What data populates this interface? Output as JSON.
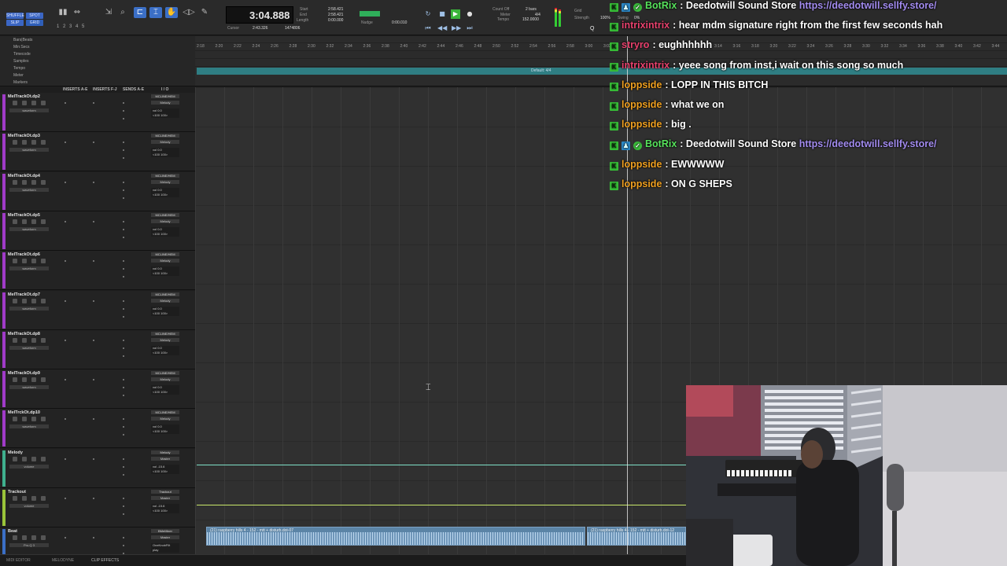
{
  "toolbar": {
    "mode_buttons": [
      "SHUFFLE",
      "SPOT",
      "SLIP",
      "GRID"
    ],
    "zoom_presets": [
      "1",
      "2",
      "3",
      "4",
      "5"
    ],
    "main_counter": "3:04.888",
    "counter_labels": [
      "Start",
      "End",
      "Length"
    ],
    "counter_values": [
      "2:58.421",
      "2:58.421",
      "0:00.000"
    ],
    "cursor_label": "Cursor",
    "cursor_value": "2:43.326",
    "samples_value": "1474806",
    "nudge_label": "Nudge",
    "nudge_value": "0:00.010",
    "count_off": "Count Off",
    "meter_label": "Meter",
    "tempo_label": "Tempo",
    "meter_value": "4/4",
    "tempo_value": "152.0000",
    "bars_label": "2 bars",
    "grid_label": "Grid",
    "strength_label": "Strength",
    "swing_label": "Swing",
    "strength_value": "100%",
    "swing_value": "0%"
  },
  "rulers": {
    "labels": [
      "Bars|Beats",
      "Min:Secs",
      "Timecode",
      "Samples",
      "Tempo",
      "Meter",
      "Markers"
    ],
    "bar_ticks": [
      "2:18",
      "2:20",
      "2:22",
      "2:24",
      "2:26",
      "2:28",
      "2:30",
      "2:32",
      "2:34",
      "2:36",
      "2:38",
      "2:40",
      "2:42",
      "2:44",
      "2:46",
      "2:48",
      "2:50",
      "2:52",
      "2:54",
      "2:56",
      "2:58",
      "3:00",
      "3:02",
      "3:04",
      "3:06",
      "3:08",
      "3:10",
      "3:12",
      "3:14",
      "3:16",
      "3:18",
      "3:20",
      "3:22",
      "3:24",
      "3:26",
      "3:28",
      "3:30",
      "3:32",
      "3:34",
      "3:36",
      "3:38",
      "3:40",
      "3:42",
      "3:44"
    ],
    "tempo_marker": "Default: 4/4"
  },
  "columns": [
    "INSERTS A-E",
    "INSERTS F-J",
    "SENDS A-E",
    "I / O"
  ],
  "tracks": [
    {
      "name": "MelTrackOt.dp2",
      "io": "MCLINE/HEM",
      "io2": "Melody",
      "view": "waveform",
      "vol": "vol 0.0",
      "pan": "<100 100>",
      "color": "#a03bc8"
    },
    {
      "name": "MelTrackOt.dp3",
      "io": "MCLINE/HEM",
      "io2": "Melody",
      "view": "waveform",
      "vol": "vol 0.0",
      "pan": "<100 100>",
      "color": "#a03bc8"
    },
    {
      "name": "MelTrackOt.dp4",
      "io": "MCLINE/HEM",
      "io2": "Melody",
      "view": "waveform",
      "vol": "vol 0.0",
      "pan": "<100 100>",
      "color": "#a03bc8"
    },
    {
      "name": "MelTrackOt.dp5",
      "io": "MCLINE/HEM",
      "io2": "Melody",
      "view": "waveform",
      "vol": "vol 0.0",
      "pan": "<100 100>",
      "color": "#a03bc8"
    },
    {
      "name": "MelTrackOt.dp6",
      "io": "MCLINE/HEM",
      "io2": "Melody",
      "view": "waveform",
      "vol": "vol 0.0",
      "pan": "<100 100>",
      "color": "#a03bc8"
    },
    {
      "name": "MelTrackOt.dp7",
      "io": "MCLINE/HEM",
      "io2": "Melody",
      "view": "waveform",
      "vol": "vol 0.0",
      "pan": "<100 100>",
      "color": "#a03bc8"
    },
    {
      "name": "MelTrackOt.dp8",
      "io": "MCLINE/HEM",
      "io2": "Melody",
      "view": "waveform",
      "vol": "vol 0.0",
      "pan": "<100 100>",
      "color": "#a03bc8"
    },
    {
      "name": "MelTrackOt.dp9",
      "io": "MCLINE/HEM",
      "io2": "Melody",
      "view": "waveform",
      "vol": "vol 0.0",
      "pan": "<100 100>",
      "color": "#a03bc8"
    },
    {
      "name": "MelTrckOt.dp10",
      "io": "MCLINE/HEM",
      "io2": "Melody",
      "view": "waveform",
      "vol": "vol 0.0",
      "pan": "<100 100>",
      "color": "#a03bc8"
    },
    {
      "name": "Melody",
      "io": "Melody",
      "io2": "Master",
      "view": "volume",
      "vol": "vol -15.6",
      "pan": "<100 100>",
      "color": "#3fb08e"
    },
    {
      "name": "Trackout",
      "io": "Trackout",
      "io2": "Master",
      "view": "volume",
      "vol": "vol -15.6",
      "pan": "<100 100>",
      "color": "#9ac43a"
    },
    {
      "name": "Beat",
      "io": "BMeMixer",
      "io2": "Master",
      "view": "Pro-Q 3",
      "vol": "OneKnobFilt",
      "pan": "play",
      "color": "#3b6fc6"
    }
  ],
  "clips": [
    {
      "label": "(21) raspberry hills 4 - 152 - mtt + disturb.dot-07"
    },
    {
      "label": "(21) raspberry hills 4 - 152 - mtt + disturb.dot-12"
    }
  ],
  "bottom_tabs": [
    "MIDI EDITOR",
    "MELODYNE",
    "CLIP EFFECTS"
  ],
  "chat": [
    {
      "user": "BotRix",
      "user_color": "#57e35c",
      "badges": [
        "k",
        "bot",
        "v"
      ],
      "message": "Deedotwill Sound Store",
      "link": "https://deedotwill.sellfy.store/"
    },
    {
      "user": "intrixintrix",
      "user_color": "#e8416d",
      "badges": [
        "k"
      ],
      "message": "hear mdm signature right from the first few seconds hah",
      "link": ""
    },
    {
      "user": "stryro",
      "user_color": "#e8416d",
      "badges": [
        "k"
      ],
      "message": "eughhhhhh",
      "link": ""
    },
    {
      "user": "intrixintrix",
      "user_color": "#e8416d",
      "badges": [
        "k"
      ],
      "message": "yeee song from inst,i wait on this song so much",
      "link": ""
    },
    {
      "user": "loppside",
      "user_color": "#f0a020",
      "badges": [
        "k"
      ],
      "message": "LOPP IN THIS BITCH",
      "link": ""
    },
    {
      "user": "loppside",
      "user_color": "#f0a020",
      "badges": [
        "k"
      ],
      "message": "what we on",
      "link": ""
    },
    {
      "user": "loppside",
      "user_color": "#f0a020",
      "badges": [
        "k"
      ],
      "message": "big .",
      "link": ""
    },
    {
      "user": "BotRix",
      "user_color": "#57e35c",
      "badges": [
        "k",
        "bot",
        "v"
      ],
      "message": "Deedotwill Sound Store",
      "link": "https://deedotwill.sellfy.store/"
    },
    {
      "user": "loppside",
      "user_color": "#f0a020",
      "badges": [
        "k"
      ],
      "message": "EWWWWW",
      "link": ""
    },
    {
      "user": "loppside",
      "user_color": "#f0a020",
      "badges": [
        "k"
      ],
      "message": "ON G SHEPS",
      "link": ""
    }
  ]
}
